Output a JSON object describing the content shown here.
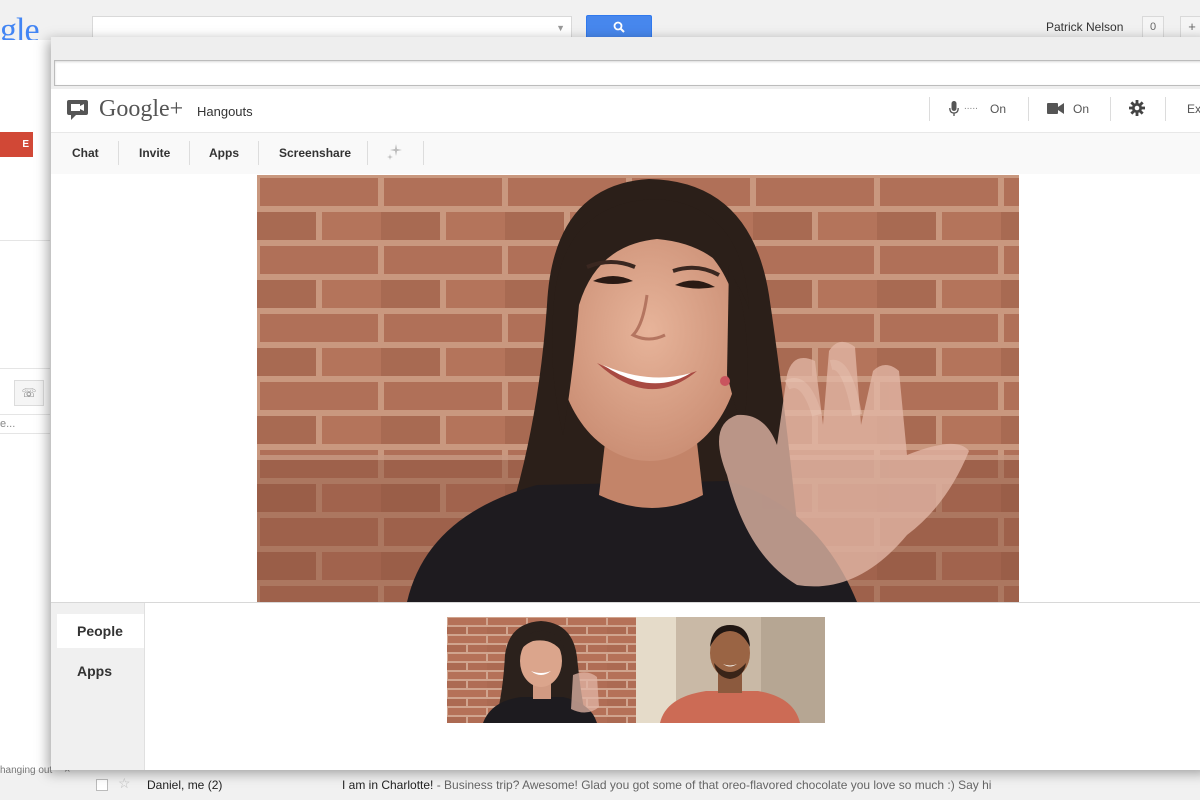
{
  "background_window": {
    "logo_text": "gle",
    "user_name": "Patrick Nelson",
    "notification_count": "0",
    "share_button": "+",
    "compose_label": "E",
    "more_label": "e...",
    "bottom_note": "hanging out",
    "bottom_note_close": "×",
    "email_row": {
      "sender": "Daniel, me (2)",
      "subject": "I am in Charlotte!",
      "snippet": " - Business trip? Awesome! Glad you got some of that oreo-flavored chocolate you love so much :) Say hi"
    }
  },
  "hangout": {
    "logo_text": "Google+",
    "logo_sub": "Hangouts",
    "controls": {
      "mic_level": ".....",
      "mic_status": "On",
      "camera_status": "On",
      "exit_label": "Ex"
    },
    "tabs": [
      "Chat",
      "Invite",
      "Apps",
      "Screenshare"
    ],
    "side_tabs": {
      "people": "People",
      "apps": "Apps"
    }
  },
  "colors": {
    "search_blue": "#4787ed",
    "compose_red": "#d14836",
    "brick": "#b07058",
    "mortar": "#d0a48e"
  }
}
